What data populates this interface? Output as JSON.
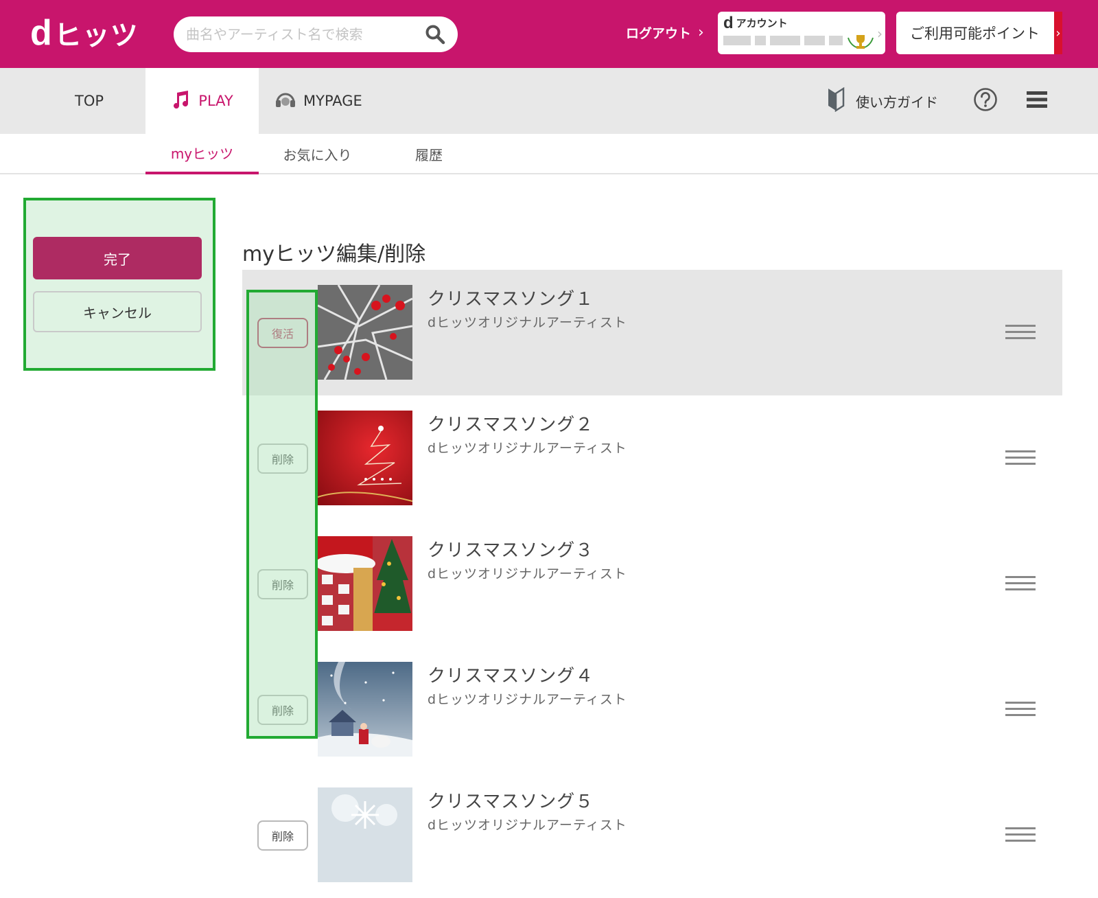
{
  "header": {
    "logo_mark": "d",
    "logo_text": "ヒッツ",
    "search_placeholder": "曲名やアーティスト名で検索",
    "logout_label": "ログアウト",
    "account_mark": "d",
    "account_label": "アカウント",
    "points_label": "ご利用可能ポイント",
    "brand_color": "#c8156c"
  },
  "nav": {
    "top": "TOP",
    "play": "PLAY",
    "mypage": "MYPAGE",
    "guide": "使い方ガイド"
  },
  "subnav": {
    "myhits": "myヒッツ",
    "favorites": "お気に入り",
    "history": "履歴"
  },
  "actions": {
    "done_label": "完了",
    "cancel_label": "キャンセル"
  },
  "page": {
    "title": "myヒッツ編集/削除"
  },
  "songs": [
    {
      "title": "クリスマスソング１",
      "artist": "dヒッツオリジナルアーティスト",
      "action": "復活"
    },
    {
      "title": "クリスマスソング２",
      "artist": "dヒッツオリジナルアーティスト",
      "action": "削除"
    },
    {
      "title": "クリスマスソング３",
      "artist": "dヒッツオリジナルアーティスト",
      "action": "削除"
    },
    {
      "title": "クリスマスソング４",
      "artist": "dヒッツオリジナルアーティスト",
      "action": "削除"
    },
    {
      "title": "クリスマスソング５",
      "artist": "dヒッツオリジナルアーティスト",
      "action": "削除"
    }
  ]
}
